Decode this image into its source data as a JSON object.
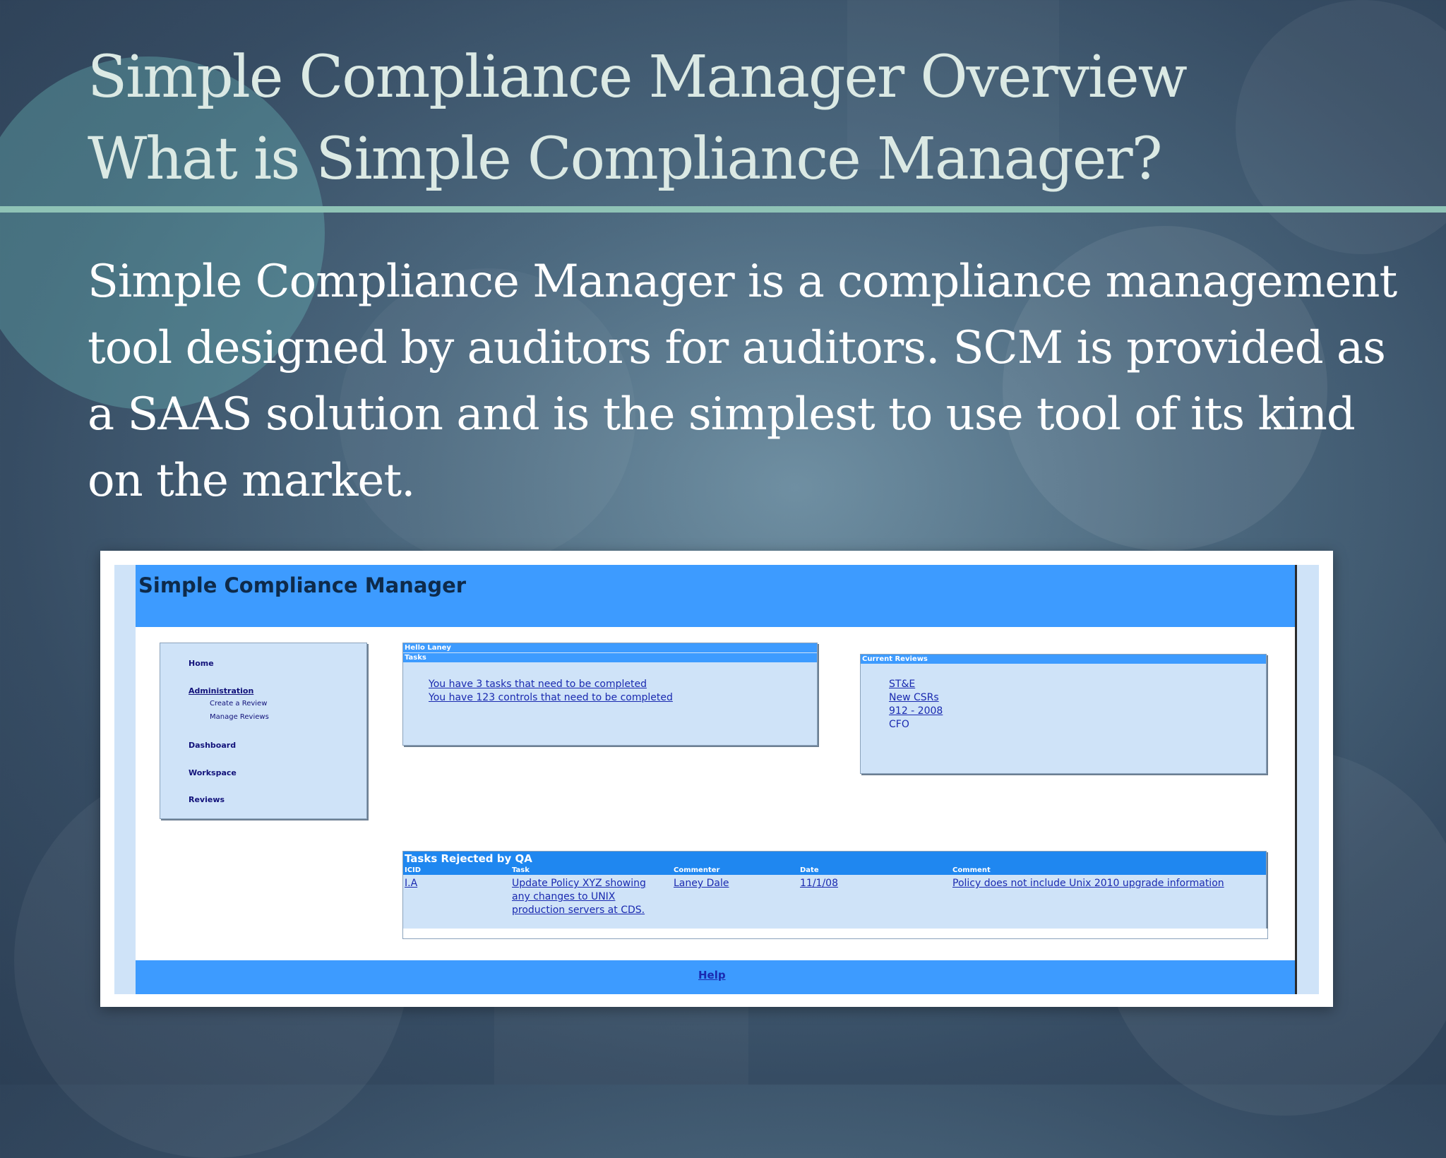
{
  "slide": {
    "title_line1": "Simple Compliance Manager Overview",
    "title_line2": "What is Simple Compliance Manager?",
    "body": "Simple Compliance Manager is a compliance management tool designed by auditors for auditors. SCM is provided as a SAAS solution and is the simplest to use tool of its kind on the market."
  },
  "app": {
    "title": "Simple Compliance Manager",
    "nav": {
      "home": "Home",
      "administration": "Administration",
      "create_review": "Create a Review",
      "manage_reviews": "Manage Reviews",
      "dashboard": "Dashboard",
      "workspace": "Workspace",
      "reviews": "Reviews"
    },
    "greeting": "Hello Laney",
    "tasks": {
      "header": "Tasks",
      "items": [
        "You have 3 tasks that need to be completed",
        "You have 123 controls that need to be completed"
      ]
    },
    "current_reviews": {
      "header": "Current Reviews",
      "items": [
        "ST&E",
        "New CSRs",
        "912 - 2008",
        "CFO"
      ]
    },
    "rejected": {
      "title": "Tasks Rejected by QA",
      "columns": [
        "ICID",
        "Task",
        "Commenter",
        "Date",
        "Comment"
      ],
      "rows": [
        {
          "icid": "I.A",
          "task_lines": [
            "Update Policy XYZ showing",
            "any changes to UNIX",
            "production servers at CDS."
          ],
          "commenter": "Laney Dale",
          "date": "11/1/08",
          "comment": "Policy does not include Unix 2010 upgrade information"
        }
      ]
    },
    "footer": {
      "help": "Help"
    }
  },
  "colors": {
    "app_header": "#3d9bff",
    "app_panel": "#cfe3f8",
    "link": "#1a2ab0",
    "title_text": "#dbe9e4",
    "rule": "#8fc3b6"
  }
}
